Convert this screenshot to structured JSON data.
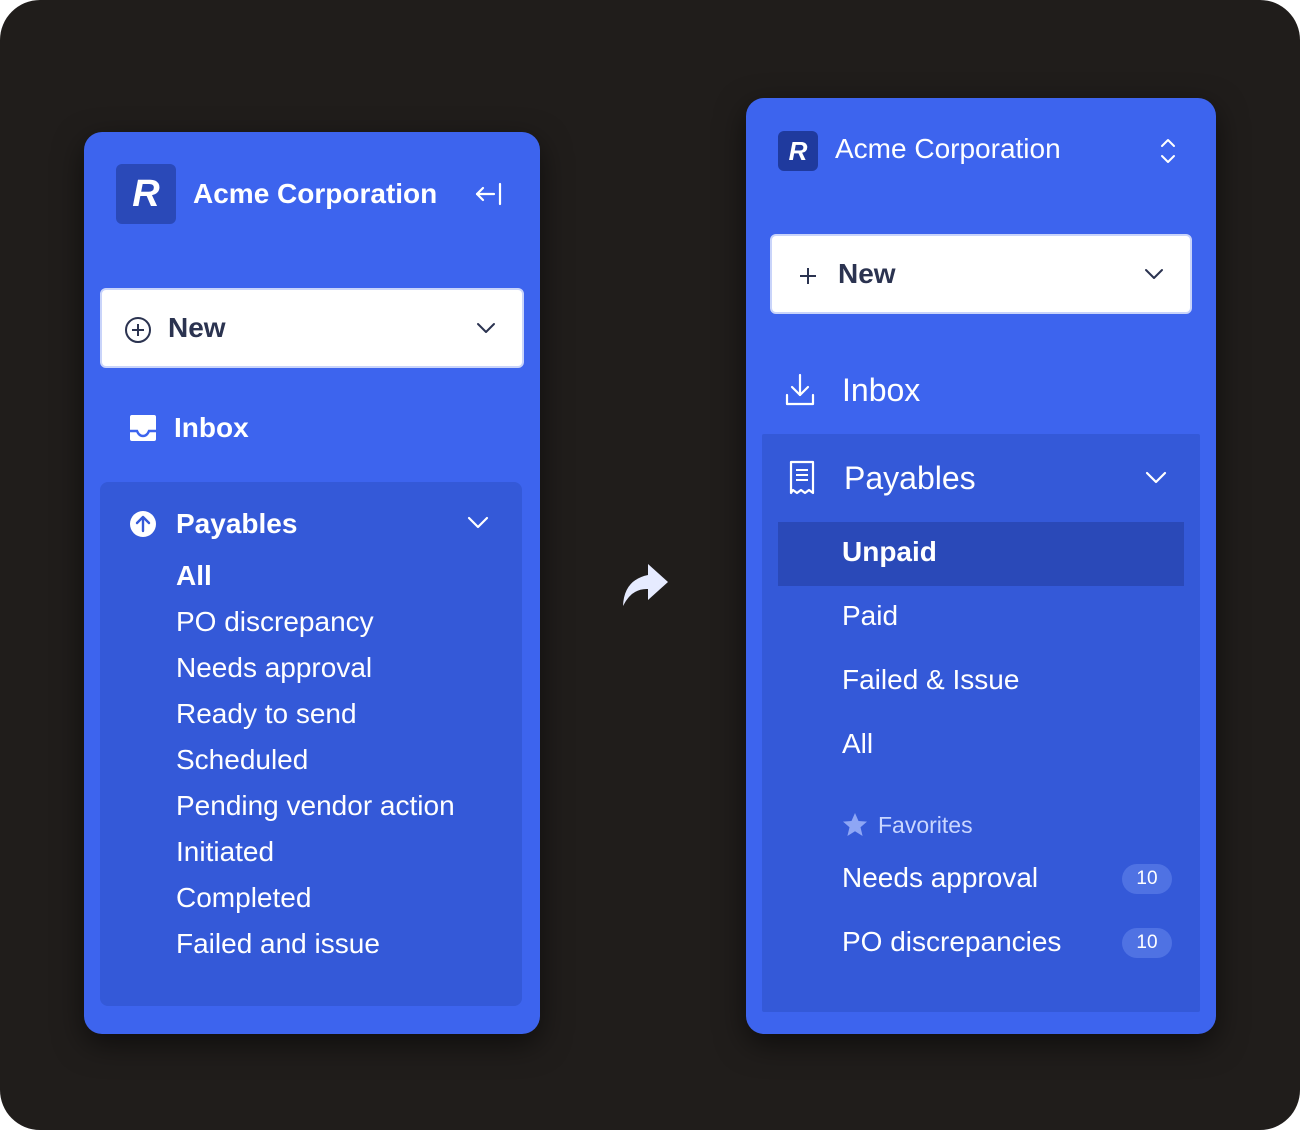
{
  "left": {
    "org_name": "Acme Corporation",
    "logo_letter": "R",
    "collapse_icon": "collapse-left-icon",
    "new_label": "New",
    "inbox_label": "Inbox",
    "payables_label": "Payables",
    "payables_items": [
      "All",
      "PO discrepancy",
      "Needs approval",
      "Ready to send",
      "Scheduled",
      "Pending vendor action",
      "Initiated",
      "Completed",
      "Failed and issue"
    ]
  },
  "arrow_icon": "share-forward-icon",
  "right": {
    "org_name": "Acme Corporation",
    "logo_letter": "R",
    "switch_icon": "chevron-up-down-icon",
    "new_label": "New",
    "inbox_label": "Inbox",
    "payables_label": "Payables",
    "payables_items": [
      "Unpaid",
      "Paid",
      "Failed & Issue",
      "All"
    ],
    "favorites_label": "Favorites",
    "favorites": [
      {
        "label": "Needs approval",
        "count": "10"
      },
      {
        "label": "PO discrepancies",
        "count": "10"
      }
    ]
  },
  "colors": {
    "panel": "#3d64ee",
    "group": "#3459d8",
    "selected": "#2a49b8",
    "background": "#201d1b"
  }
}
